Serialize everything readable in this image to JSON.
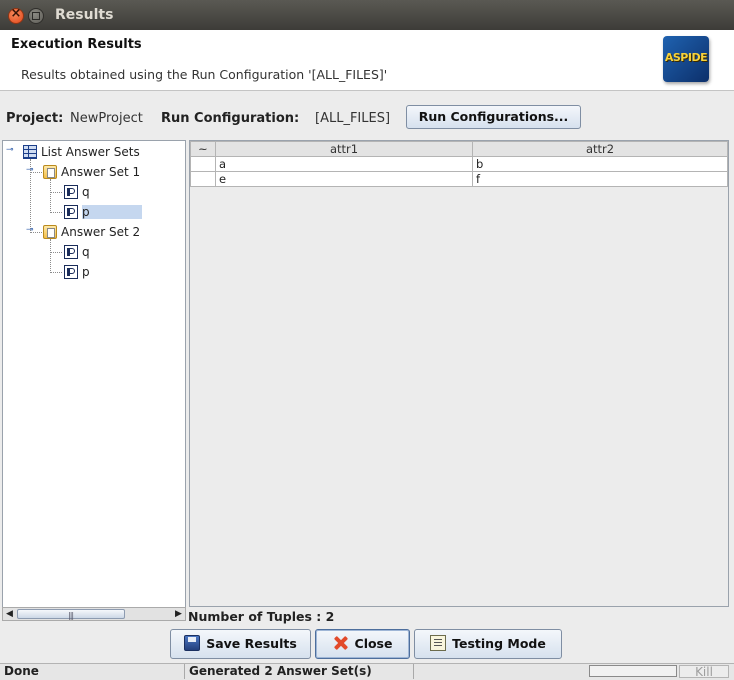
{
  "window": {
    "title": "Results"
  },
  "banner": {
    "title": "Execution Results",
    "description": "Results obtained using the Run Configuration '[ALL_FILES]'",
    "logo_text": "ASPIDE"
  },
  "project_row": {
    "project_label": "Project:",
    "project_value": "NewProject",
    "runconf_label": "Run Configuration:",
    "runconf_value": "[ALL_FILES]",
    "runconf_button": "Run Configurations..."
  },
  "tree": {
    "root": "List Answer Sets",
    "sets": [
      {
        "label": "Answer Set 1",
        "children": [
          "q",
          "p"
        ]
      },
      {
        "label": "Answer Set 2",
        "children": [
          "q",
          "p"
        ]
      }
    ],
    "selected": "Answer Set 1 / p"
  },
  "table": {
    "corner": "~",
    "columns": [
      "attr1",
      "attr2"
    ],
    "rows": [
      [
        "a",
        "b"
      ],
      [
        "e",
        "f"
      ]
    ]
  },
  "tuples_text": "Number of Tuples : 2",
  "buttons": {
    "save": "Save Results",
    "close": "Close",
    "testing": "Testing Mode"
  },
  "status": {
    "left": "Done",
    "middle": "Generated 2 Answer Set(s)",
    "kill": "Kill"
  },
  "icons": {
    "title_close": "close-icon",
    "title_maximize": "maximize-icon",
    "tree_root": "table-icon",
    "answer_set": "folder-icon",
    "predicate": "document-icon",
    "save": "save-icon",
    "close": "x-icon",
    "testing": "clipboard-icon"
  },
  "scrollbar_grip": "|||"
}
